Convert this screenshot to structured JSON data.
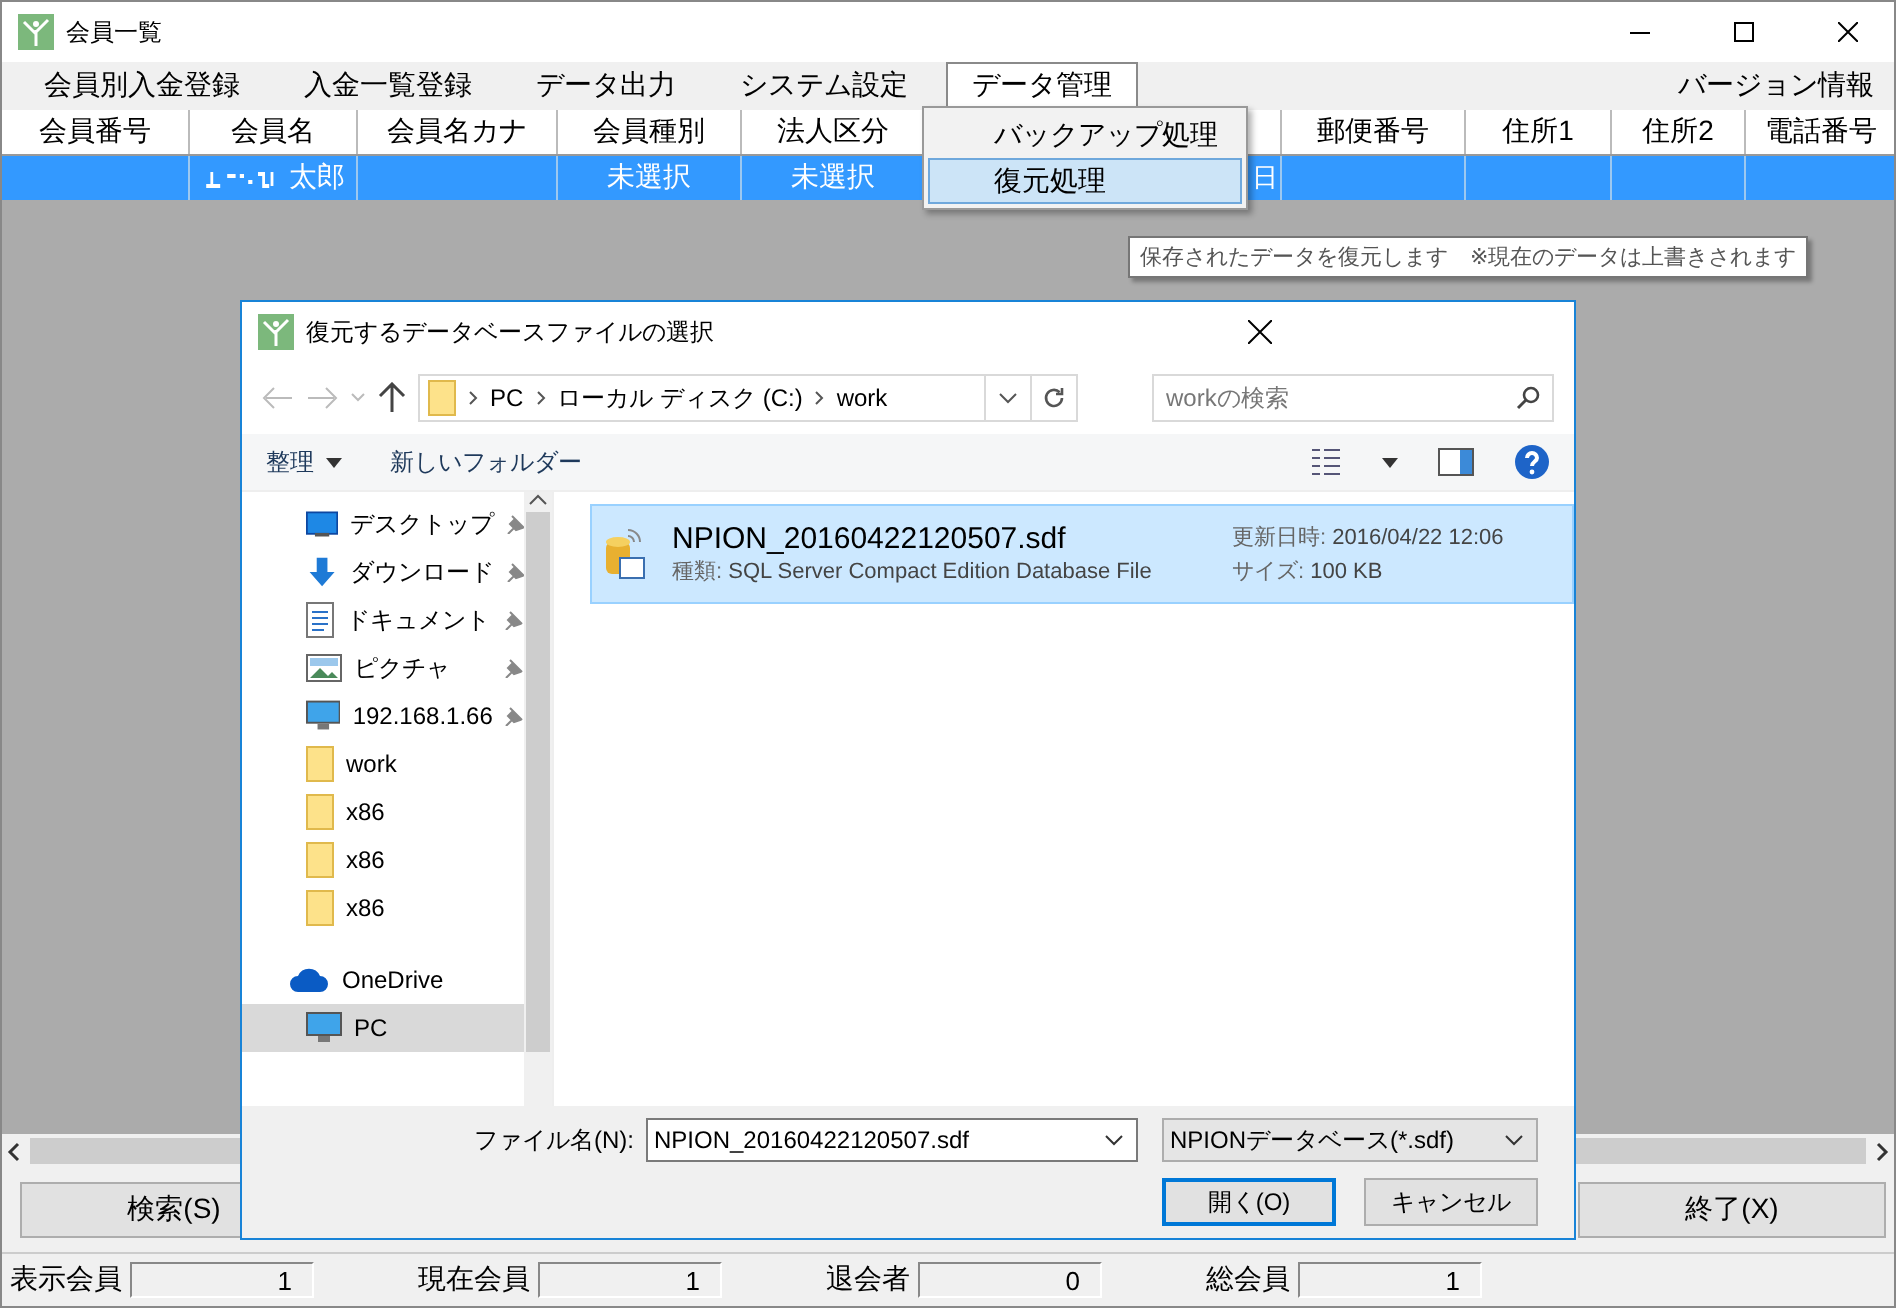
{
  "window": {
    "title": "会員一覧"
  },
  "menu": {
    "items": [
      {
        "label": "会員別入金登録",
        "selected": false
      },
      {
        "label": "入金一覧登録",
        "selected": false
      },
      {
        "label": "データ出力",
        "selected": false
      },
      {
        "label": "システム設定",
        "selected": false
      },
      {
        "label": "データ管理",
        "selected": true
      }
    ],
    "version": "バージョン情報"
  },
  "dropdown": {
    "items": [
      {
        "label": "バックアップ処理",
        "selected": false
      },
      {
        "label": "復元処理",
        "selected": true
      }
    ]
  },
  "tooltip": "保存されたデータを復元します　※現在のデータは上書きされます",
  "table": {
    "columns": [
      "会員番号",
      "会員名",
      "会員名カナ",
      "会員種別",
      "法人区分",
      null,
      "郵便番号",
      "住所1",
      "住所2",
      "電話番号"
    ],
    "rows": [
      {
        "selected": true,
        "cells": [
          null,
          "太郎",
          null,
          "未選択",
          "未選択",
          "日",
          null,
          null,
          null,
          null
        ]
      }
    ]
  },
  "buttons": [
    "検索(S)",
    "終了(X)"
  ],
  "status_bar": [
    {
      "label": "表示会員",
      "value": "1"
    },
    {
      "label": "現在会員",
      "value": "1"
    },
    {
      "label": "退会者",
      "value": "0"
    },
    {
      "label": "総会員",
      "value": "1"
    }
  ],
  "dialog": {
    "title": "復元するデータベースファイルの選択",
    "address": [
      "PC",
      "ローカル ディスク (C:)",
      "work"
    ],
    "search_placeholder": "workの検索",
    "organize": "整理",
    "new_folder": "新しいフォルダー",
    "nav": [
      {
        "kind": "desktop",
        "label": "デスクトップ",
        "pinned": true,
        "selected": false
      },
      {
        "kind": "download",
        "label": "ダウンロード",
        "pinned": true,
        "selected": false
      },
      {
        "kind": "document",
        "label": "ドキュメント",
        "pinned": true,
        "selected": false
      },
      {
        "kind": "picture",
        "label": "ピクチャ",
        "pinned": true,
        "selected": false
      },
      {
        "kind": "monitor",
        "label": "192.168.1.66",
        "pinned": true,
        "selected": false
      },
      {
        "kind": "folder",
        "label": "work",
        "pinned": false,
        "selected": false
      },
      {
        "kind": "folder",
        "label": "x86",
        "pinned": false,
        "selected": false
      },
      {
        "kind": "folder",
        "label": "x86",
        "pinned": false,
        "selected": false
      },
      {
        "kind": "folder",
        "label": "x86",
        "pinned": false,
        "selected": false
      },
      {
        "kind": "cloud",
        "label": "OneDrive",
        "pinned": false,
        "selected": false
      },
      {
        "kind": "monitor",
        "label": "PC",
        "pinned": false,
        "selected": true
      }
    ],
    "files": [
      {
        "name": "NPION_20160422120507.sdf",
        "type_label": "種類:",
        "type": "SQL Server Compact Edition Database File",
        "modified_label": "更新日時:",
        "modified": "2016/04/22 12:06",
        "size_label": "サイズ:",
        "size": "100 KB",
        "selected": true
      }
    ],
    "filename_label": "ファイル名(N):",
    "filename": "NPION_20160422120507.sdf",
    "filter": "NPIONデータベース(*.sdf)",
    "open": "開く(O)",
    "cancel": "キャンセル"
  }
}
